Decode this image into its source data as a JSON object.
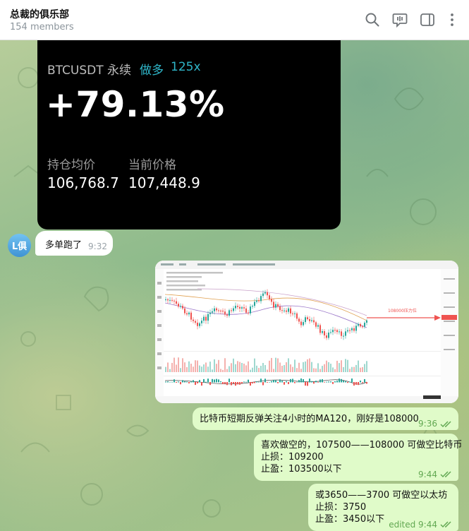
{
  "header": {
    "title": "总裁的俱乐部",
    "subtitle": "154 members",
    "icons": [
      "search-icon",
      "video-chat-icon",
      "sidebar-toggle-icon",
      "more-vertical-icon"
    ]
  },
  "pnl_card": {
    "symbol": "BTCUSDT 永续",
    "direction": "做多",
    "leverage": "125x",
    "pnl_percent": "+79.13%",
    "entry_label": "持仓均价",
    "entry_value": "106,768.7",
    "current_label": "当前价格",
    "current_value": "107,448.9"
  },
  "incoming": {
    "avatar_initials": "L俱",
    "text": "多单跑了",
    "time": "9:32"
  },
  "chart_image": {
    "annotation": "108000压力位",
    "colors": {
      "up": "#26a69a",
      "down": "#ef5350",
      "arrow": "#ef5350"
    }
  },
  "outgoing": [
    {
      "lines": [
        "比特币短期反弹关注4小时的MA120，刚好是108000"
      ],
      "time": "9:36"
    },
    {
      "lines": [
        "喜欢做空的，107500——108000 可做空比特币",
        "止损：109200",
        "止盈：103500以下"
      ],
      "time": "9:44"
    },
    {
      "lines": [
        "或3650——3700 可做空以太坊",
        "止损：3750",
        "止盈：3450以下"
      ],
      "time": "edited 9:44"
    }
  ]
}
